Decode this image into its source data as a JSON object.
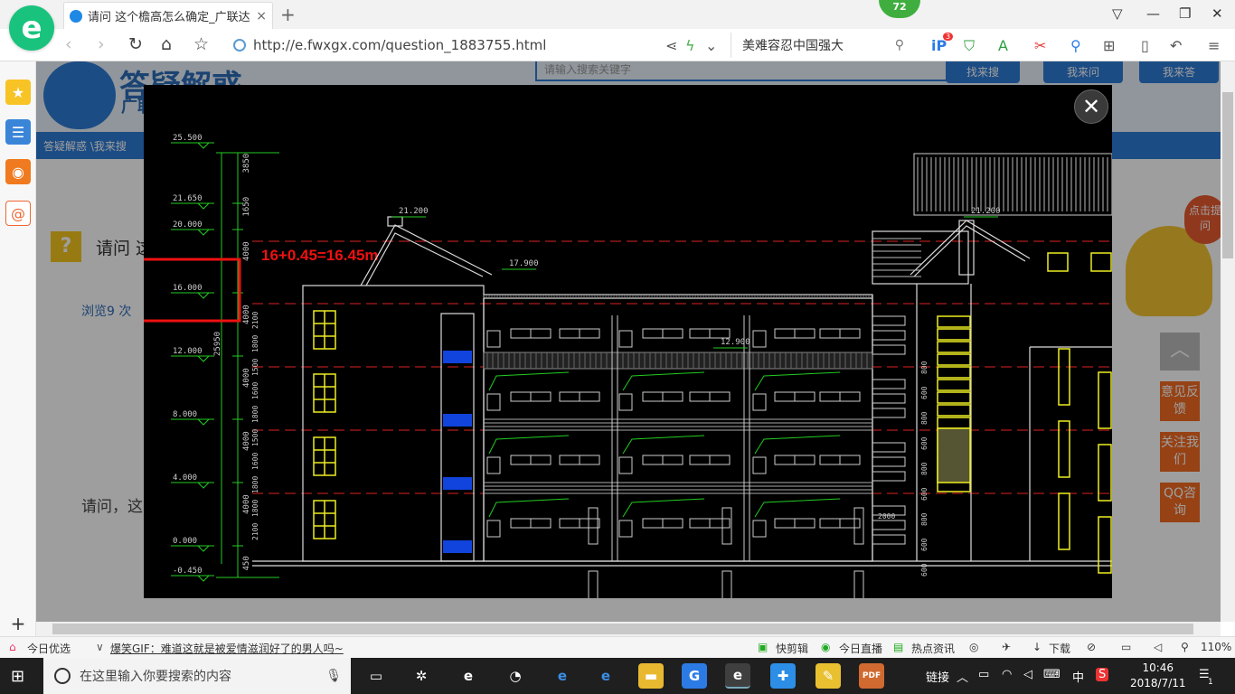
{
  "browser": {
    "logo_letter": "e",
    "tab_title": "请问 这个檐高怎么确定_广联达服务",
    "tab_close": "×",
    "new_tab": "+",
    "badge_count": "72",
    "url": "http://e.fwxgx.com/question_1883755.html",
    "search_text": "美难容忍中国强大",
    "ext_badge": "3"
  },
  "page": {
    "brand": "答疑解惑",
    "brand_sub": "广联",
    "search_placeholder": "请输入搜索关键字",
    "buttons": [
      "找来搜",
      "我来问",
      "我来答"
    ],
    "breadcrumb": "答疑解惑 \\我来搜",
    "question_title": "请问 这",
    "views": "浏览9 次",
    "question_text": "请问，这",
    "bubble_text": "点击提问",
    "side_buttons": [
      "意见反馈",
      "关注我们",
      "QQ咨询"
    ],
    "totop": "︿"
  },
  "drawing": {
    "annotation": "16+0.45=16.45m",
    "elevation_labels": [
      "25.500",
      "21.650",
      "20.000",
      "16.000",
      "12.000",
      "8.000",
      "4.000",
      "0.000",
      "-0.450"
    ],
    "dim_labels": [
      "3850",
      "1650",
      "4000",
      "4000",
      "4000",
      "4000",
      "4000",
      "450"
    ],
    "total_dim": "25950",
    "roof_labels": [
      "21.200",
      "17.900",
      "21.200",
      "12.900"
    ],
    "right_dims": [
      "800",
      "600",
      "800",
      "600",
      "800",
      "600",
      "800",
      "600",
      "600",
      "2000"
    ],
    "inner_dims": [
      "2100",
      "1800",
      "1500",
      "1600",
      "1800",
      "1500",
      "1600",
      "1800",
      "1800",
      "2100"
    ]
  },
  "status": {
    "left_label": "今日优选",
    "news": "爆笑GIF：难道这就是被爱情滋润好了的男人吗~",
    "items": [
      "快剪辑",
      "今日直播",
      "热点资讯",
      "下载"
    ],
    "zoom": "110%"
  },
  "taskbar": {
    "search_placeholder": "在这里输入你要搜索的内容",
    "tray_link": "链接",
    "ime": "中",
    "time": "10:46",
    "date": "2018/7/11",
    "notify_count": "1"
  }
}
